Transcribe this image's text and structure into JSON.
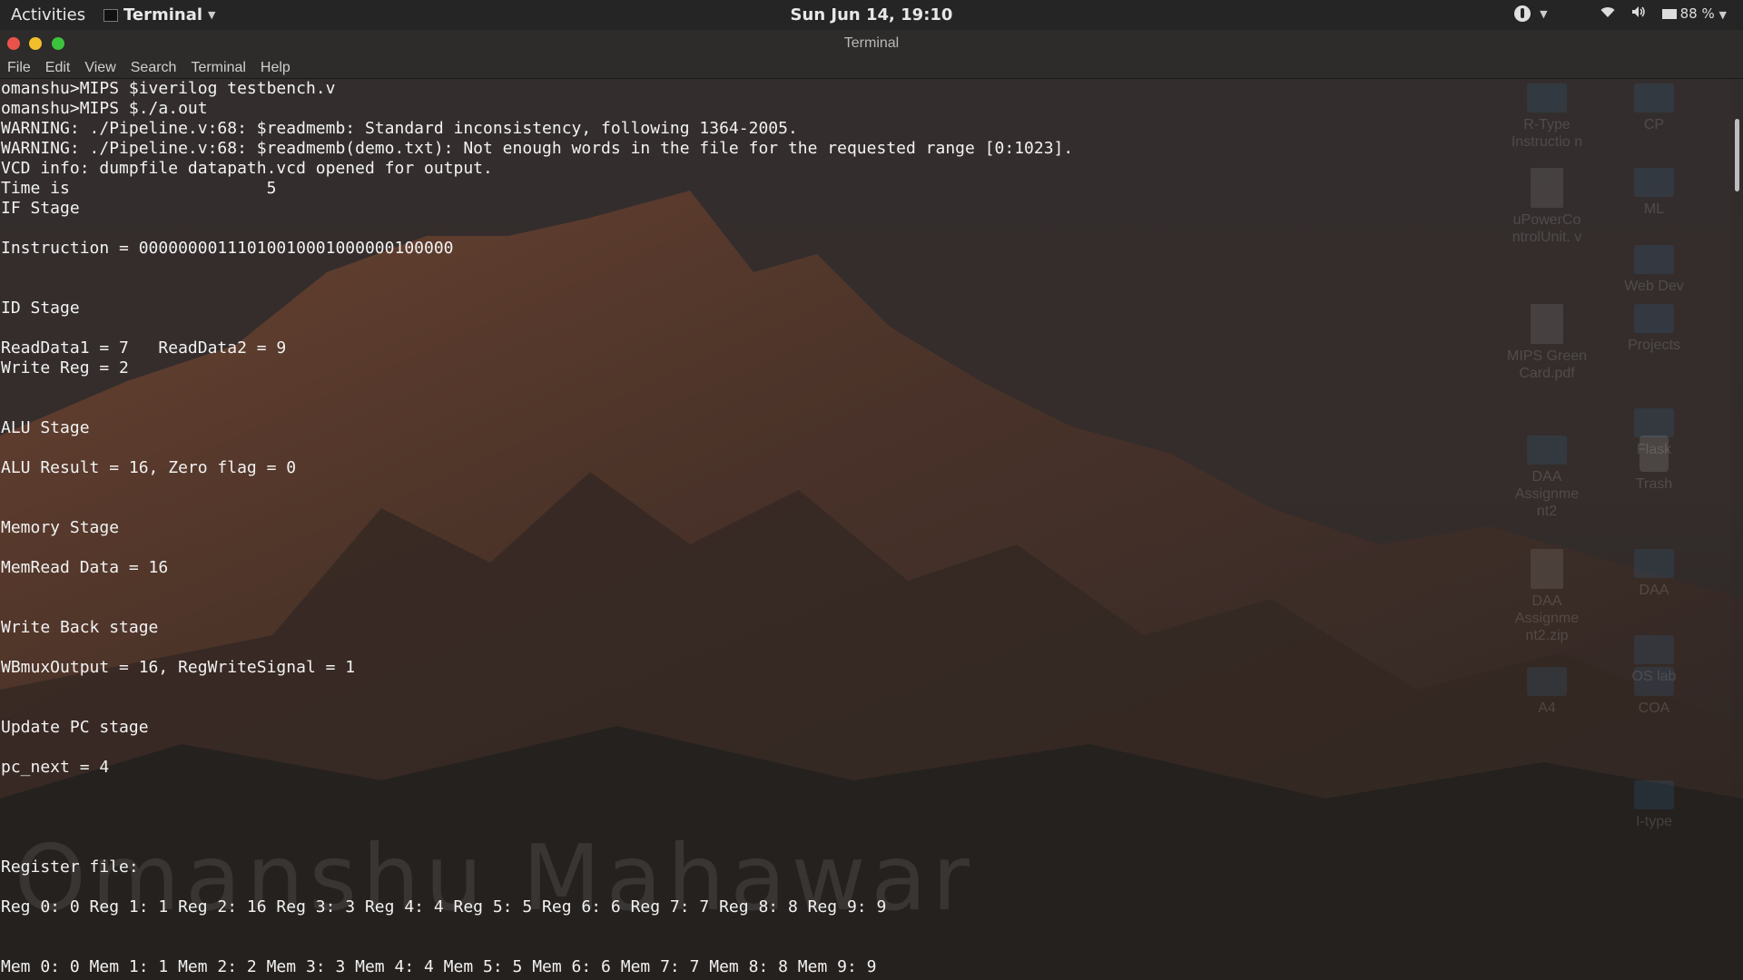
{
  "topbar": {
    "activities": "Activities",
    "app_name": "Terminal",
    "clock": "Sun Jun 14, 19:10",
    "battery": "88 %"
  },
  "window": {
    "title": "Terminal",
    "menu": [
      "File",
      "Edit",
      "View",
      "Search",
      "Terminal",
      "Help"
    ]
  },
  "terminal": {
    "lines": [
      "omanshu>MIPS $iverilog testbench.v",
      "omanshu>MIPS $./a.out",
      "WARNING: ./Pipeline.v:68: $readmemb: Standard inconsistency, following 1364-2005.",
      "WARNING: ./Pipeline.v:68: $readmemb(demo.txt): Not enough words in the file for the requested range [0:1023].",
      "VCD info: dumpfile datapath.vcd opened for output.",
      "Time is                    5",
      "IF Stage",
      "",
      "Instruction = 00000000111010010001000000100000",
      "",
      "",
      "ID Stage",
      "",
      "ReadData1 = 7   ReadData2 = 9",
      "Write Reg = 2",
      "",
      "",
      "ALU Stage",
      "",
      "ALU Result = 16, Zero flag = 0",
      "",
      "",
      "Memory Stage",
      "",
      "MemRead Data = 16",
      "",
      "",
      "Write Back stage",
      "",
      "WBmuxOutput = 16, RegWriteSignal = 1",
      "",
      "",
      "Update PC stage",
      "",
      "pc_next = 4",
      "",
      "",
      "",
      "",
      "Register file:",
      "",
      "Reg 0: 0 Reg 1: 1 Reg 2: 16 Reg 3: 3 Reg 4: 4 Reg 5: 5 Reg 6: 6 Reg 7: 7 Reg 8: 8 Reg 9: 9",
      "",
      "",
      "Mem 0: 0 Mem 1: 1 Mem 2: 2 Mem 3: 3 Mem 4: 4 Mem 5: 5 Mem 6: 6 Mem 7: 7 Mem 8: 8 Mem 9: 9"
    ],
    "watermark": "Omanshu Mahawar"
  },
  "desktop_icons": [
    {
      "label": "R-Type Instructio n",
      "kind": "folder",
      "col": 0,
      "row": 0
    },
    {
      "label": "CP",
      "kind": "folder",
      "col": 1,
      "row": 0
    },
    {
      "label": "uPowerCo ntrolUnit. v",
      "kind": "doc",
      "col": 0,
      "row": 1
    },
    {
      "label": "ML",
      "kind": "folder",
      "col": 1,
      "row": 1
    },
    {
      "label": "Web Dev",
      "kind": "folder",
      "col": 1,
      "row": 2
    },
    {
      "label": "MIPS Green Card.pdf",
      "kind": "doc",
      "col": 0,
      "row": 3
    },
    {
      "label": "Projects",
      "kind": "folder",
      "col": 1,
      "row": 3
    },
    {
      "label": "Flask",
      "kind": "folder",
      "col": 1,
      "row": 4
    },
    {
      "label": "DAA Assignme nt2",
      "kind": "folder",
      "col": 0,
      "row": 5
    },
    {
      "label": "Trash",
      "kind": "bin",
      "col": 1,
      "row": 5
    },
    {
      "label": "DAA",
      "kind": "folder",
      "col": 1,
      "row": 6
    },
    {
      "label": "DAA Assignme nt2.zip",
      "kind": "doc",
      "col": 0,
      "row": 6
    },
    {
      "label": "OS lab",
      "kind": "folder",
      "col": 1,
      "row": 7
    },
    {
      "label": "A4",
      "kind": "folder",
      "col": 0,
      "row": 8
    },
    {
      "label": "COA",
      "kind": "folder",
      "col": 1,
      "row": 8
    },
    {
      "label": "I-type",
      "kind": "folder",
      "col": 1,
      "row": 9
    }
  ]
}
